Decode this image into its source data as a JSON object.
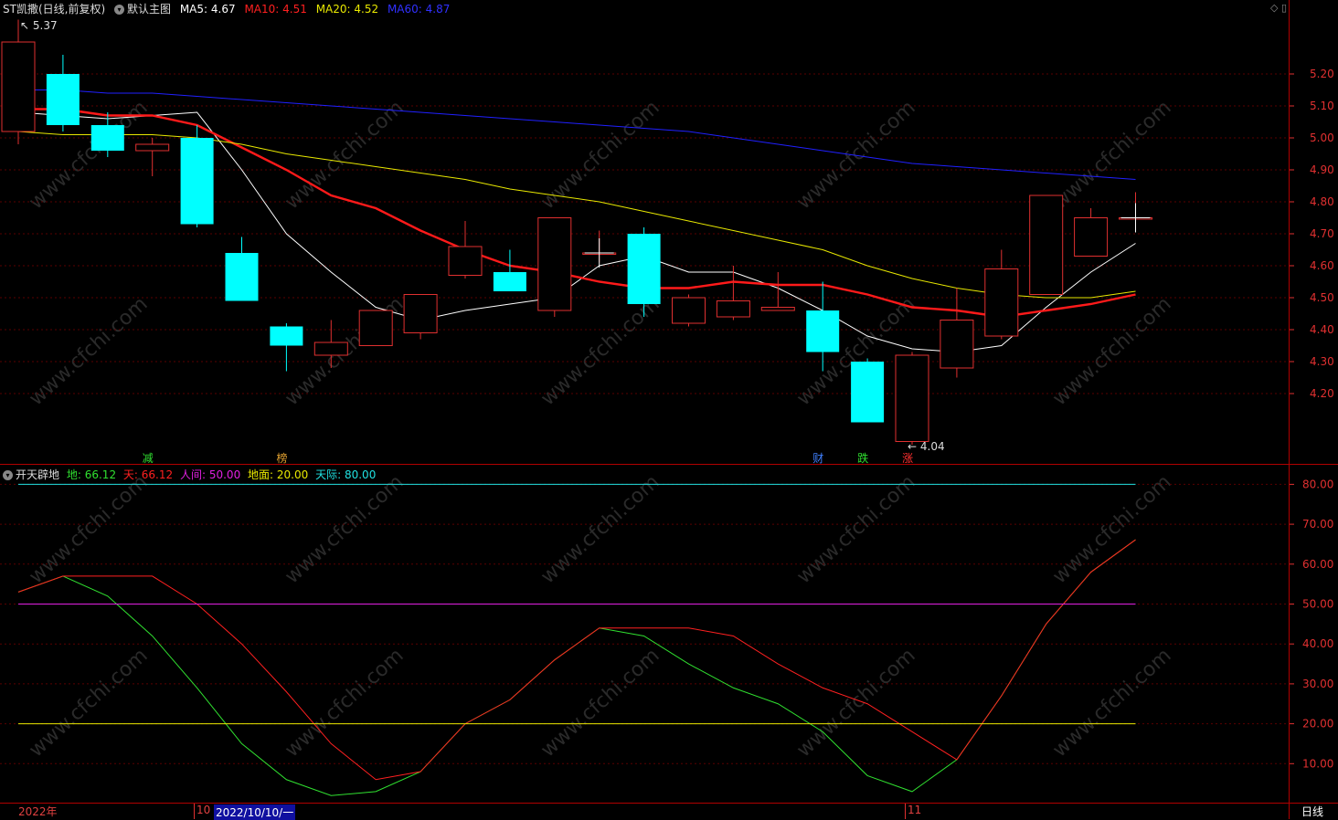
{
  "header": {
    "stock_name": "ST凯撒(日线,前复权)",
    "indicator_name": "默认主图",
    "ma5_label": "MA5:",
    "ma5_value": "4.67",
    "ma10_label": "MA10:",
    "ma10_value": "4.51",
    "ma20_label": "MA20:",
    "ma20_value": "4.52",
    "ma60_label": "MA60:",
    "ma60_value": "4.87"
  },
  "sub_header": {
    "indicator_name": "开天辟地",
    "di_label": "地:",
    "di_value": "66.12",
    "tian_label": "天:",
    "tian_value": "66.12",
    "renjian_label": "人间:",
    "renjian_value": "50.00",
    "dimian_label": "地面:",
    "dimian_value": "20.00",
    "tianji_label": "天际:",
    "tianji_value": "80.00"
  },
  "bottom": {
    "year_label": "2022年",
    "month_oct": "10",
    "cursor_date": "2022/10/10/一",
    "month_nov": "11",
    "period": "日线"
  },
  "colors": {
    "up": "#e03030",
    "down": "#00ffff",
    "ma5": "#ffffff",
    "ma10": "#ff1a1a",
    "ma20": "#e8e800",
    "ma60": "#2020ff",
    "di": "#30e030",
    "tian": "#ff2020",
    "renjian": "#e020e0",
    "dimian": "#e8e800",
    "tianji": "#20e0e0",
    "axis": "#e03030"
  },
  "chart_data": [
    {
      "type": "candlestick",
      "title": "默认主图",
      "ylim": [
        4.04,
        5.37
      ],
      "y_ticks": [
        "5.20",
        "5.10",
        "5.00",
        "4.90",
        "4.80",
        "4.70",
        "4.60",
        "4.50",
        "4.40",
        "4.30",
        "4.20"
      ],
      "high_annotation": "5.37",
      "low_annotation": "4.04",
      "candles": [
        {
          "o": 5.02,
          "h": 5.37,
          "l": 4.98,
          "c": 5.3
        },
        {
          "o": 5.2,
          "h": 5.26,
          "l": 5.02,
          "c": 5.04
        },
        {
          "o": 5.04,
          "h": 5.08,
          "l": 4.94,
          "c": 4.96
        },
        {
          "o": 4.96,
          "h": 5.0,
          "l": 4.88,
          "c": 4.98
        },
        {
          "o": 5.0,
          "h": 5.04,
          "l": 4.72,
          "c": 4.73
        },
        {
          "o": 4.64,
          "h": 4.69,
          "l": 4.49,
          "c": 4.49
        },
        {
          "o": 4.41,
          "h": 4.42,
          "l": 4.27,
          "c": 4.35
        },
        {
          "o": 4.32,
          "h": 4.43,
          "l": 4.28,
          "c": 4.36
        },
        {
          "o": 4.35,
          "h": 4.46,
          "l": 4.35,
          "c": 4.46
        },
        {
          "o": 4.39,
          "h": 4.51,
          "l": 4.37,
          "c": 4.51
        },
        {
          "o": 4.57,
          "h": 4.74,
          "l": 4.56,
          "c": 4.66
        },
        {
          "o": 4.58,
          "h": 4.65,
          "l": 4.52,
          "c": 4.52
        },
        {
          "o": 4.46,
          "h": 4.75,
          "l": 4.44,
          "c": 4.75
        },
        {
          "o": 4.64,
          "h": 4.71,
          "l": 4.61,
          "c": 4.64
        },
        {
          "o": 4.7,
          "h": 4.72,
          "l": 4.44,
          "c": 4.48
        },
        {
          "o": 4.42,
          "h": 4.51,
          "l": 4.41,
          "c": 4.5
        },
        {
          "o": 4.44,
          "h": 4.6,
          "l": 4.43,
          "c": 4.49
        },
        {
          "o": 4.46,
          "h": 4.58,
          "l": 4.46,
          "c": 4.47
        },
        {
          "o": 4.46,
          "h": 4.55,
          "l": 4.27,
          "c": 4.33
        },
        {
          "o": 4.3,
          "h": 4.31,
          "l": 4.11,
          "c": 4.11
        },
        {
          "o": 4.05,
          "h": 4.33,
          "l": 4.04,
          "c": 4.32
        },
        {
          "o": 4.28,
          "h": 4.53,
          "l": 4.25,
          "c": 4.43
        },
        {
          "o": 4.38,
          "h": 4.65,
          "l": 4.37,
          "c": 4.59
        },
        {
          "o": 4.51,
          "h": 4.82,
          "l": 4.51,
          "c": 4.82
        },
        {
          "o": 4.63,
          "h": 4.78,
          "l": 4.63,
          "c": 4.75
        },
        {
          "o": 4.75,
          "h": 4.83,
          "l": 4.72,
          "c": 4.75
        }
      ],
      "series": [
        {
          "name": "MA5",
          "values": [
            5.08,
            5.07,
            5.06,
            5.07,
            5.08,
            4.9,
            4.7,
            4.58,
            4.47,
            4.43,
            4.46,
            4.48,
            4.5,
            4.6,
            4.63,
            4.58,
            4.58,
            4.53,
            4.46,
            4.38,
            4.34,
            4.33,
            4.35,
            4.47,
            4.58,
            4.67
          ]
        },
        {
          "name": "MA10",
          "values": [
            5.09,
            5.09,
            5.07,
            5.07,
            5.04,
            4.97,
            4.9,
            4.82,
            4.78,
            4.71,
            4.65,
            4.6,
            4.58,
            4.55,
            4.53,
            4.53,
            4.55,
            4.54,
            4.54,
            4.51,
            4.47,
            4.46,
            4.44,
            4.46,
            4.48,
            4.51
          ]
        },
        {
          "name": "MA20",
          "values": [
            5.02,
            5.01,
            5.01,
            5.01,
            5.0,
            4.98,
            4.95,
            4.93,
            4.91,
            4.89,
            4.87,
            4.84,
            4.82,
            4.8,
            4.77,
            4.74,
            4.71,
            4.68,
            4.65,
            4.6,
            4.56,
            4.53,
            4.51,
            4.5,
            4.5,
            4.52
          ]
        },
        {
          "name": "MA60",
          "values": [
            5.15,
            5.15,
            5.14,
            5.14,
            5.13,
            5.12,
            5.11,
            5.1,
            5.09,
            5.08,
            5.07,
            5.06,
            5.05,
            5.04,
            5.03,
            5.02,
            5.0,
            4.98,
            4.96,
            4.94,
            4.92,
            4.91,
            4.9,
            4.89,
            4.88,
            4.87
          ]
        }
      ],
      "signals": [
        {
          "index": 3,
          "label": "减",
          "color": "#30e030"
        },
        {
          "index": 6,
          "label": "榜",
          "color": "#e0a030"
        },
        {
          "index": 18,
          "label": "财",
          "color": "#4080ff"
        },
        {
          "index": 19,
          "label": "跌",
          "color": "#30e030"
        },
        {
          "index": 20,
          "label": "涨",
          "color": "#ff3030"
        }
      ]
    },
    {
      "type": "line",
      "title": "开天辟地",
      "ylim": [
        0,
        85
      ],
      "y_ticks": [
        "80.00",
        "70.00",
        "60.00",
        "50.00",
        "40.00",
        "30.00",
        "20.00",
        "10.00"
      ],
      "series": [
        {
          "name": "地",
          "values": [
            53,
            57,
            52,
            42,
            29,
            15,
            6,
            2,
            3,
            8,
            20,
            26,
            36,
            44,
            42,
            35,
            29,
            25,
            18,
            7,
            3,
            11,
            27,
            45,
            58,
            66.12
          ]
        },
        {
          "name": "天",
          "values": [
            53,
            57,
            57,
            57,
            50,
            40,
            28,
            15,
            6,
            8,
            20,
            26,
            36,
            44,
            44,
            44,
            42,
            35,
            29,
            25,
            18,
            11,
            27,
            45,
            58,
            66.12
          ]
        },
        {
          "name": "人间",
          "values": [
            50,
            50
          ]
        },
        {
          "name": "地面",
          "values": [
            20,
            20
          ]
        },
        {
          "name": "天际",
          "values": [
            80,
            80
          ]
        }
      ]
    }
  ]
}
